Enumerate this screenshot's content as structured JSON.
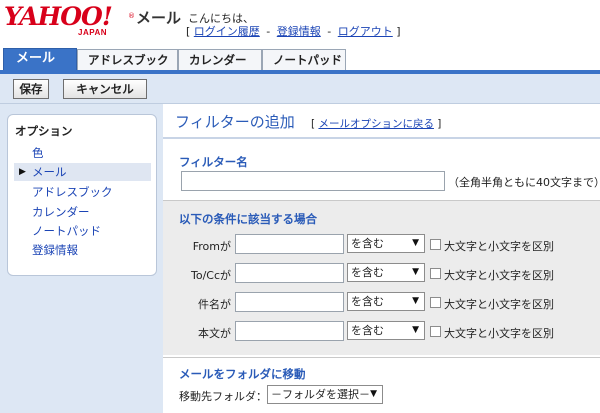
{
  "header": {
    "logo_text": "YAHOO!",
    "logo_sub": "JAPAN",
    "logo_reg": "®",
    "service_name": "メール",
    "greeting": "こんにちは、",
    "bracket_open": "[",
    "bracket_close": "]",
    "sep": "-",
    "links": [
      "ログイン履歴",
      "登録情報",
      "ログアウト"
    ]
  },
  "tabs": [
    {
      "label": "メール",
      "active": true
    },
    {
      "label": "アドレスブック",
      "active": false
    },
    {
      "label": "カレンダー",
      "active": false
    },
    {
      "label": "ノートパッド",
      "active": false
    }
  ],
  "toolbar": {
    "save_label": "保存",
    "cancel_label": "キャンセル"
  },
  "sidebar": {
    "heading": "オプション",
    "bullet": "▶",
    "items": [
      {
        "label": "色",
        "selected": false
      },
      {
        "label": "メール",
        "selected": true
      },
      {
        "label": "アドレスブック",
        "selected": false
      },
      {
        "label": "カレンダー",
        "selected": false
      },
      {
        "label": "ノートパッド",
        "selected": false
      },
      {
        "label": "登録情報",
        "selected": false
      }
    ]
  },
  "main": {
    "title": "フィルターの追加",
    "back_open": "[",
    "back_link": "メールオプションに戻る",
    "back_close": "]",
    "filter_name_label": "フィルター名",
    "filter_name_value": "",
    "filter_name_hint": "（全角半角ともに40文字まで）",
    "conditions_label": "以下の条件に該当する場合",
    "conditions": [
      {
        "label": "Fromが",
        "value": "",
        "operator": "を含む",
        "case_label": "大文字と小文字を区別",
        "case_checked": false
      },
      {
        "label": "To/Ccが",
        "value": "",
        "operator": "を含む",
        "case_label": "大文字と小文字を区別",
        "case_checked": false
      },
      {
        "label": "件名が",
        "value": "",
        "operator": "を含む",
        "case_label": "大文字と小文字を区別",
        "case_checked": false
      },
      {
        "label": "本文が",
        "value": "",
        "operator": "を含む",
        "case_label": "大文字と小文字を区別",
        "case_checked": false
      }
    ],
    "move_label": "メールをフォルダに移動",
    "dest_label": "移動先フォルダ：",
    "dest_select": "－フォルダを選択－"
  },
  "colors": {
    "brand_red": "#d8001a",
    "tab_blue": "#3a73c7",
    "link_blue": "#1b44b5",
    "toolbar_bg": "#dde7f4",
    "section_gray": "#ececec"
  },
  "icons": {
    "dropdown": "chevron-down-icon",
    "bullet": "triangle-right-icon"
  }
}
